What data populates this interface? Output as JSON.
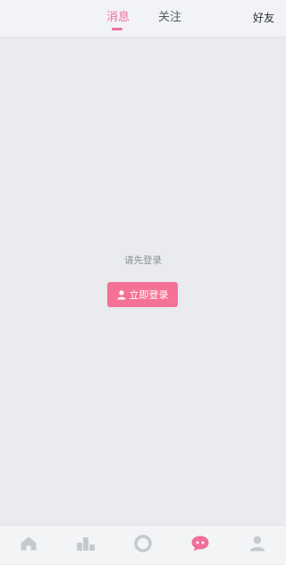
{
  "header": {
    "tabs": [
      {
        "label": "消息",
        "active": true
      },
      {
        "label": "关注",
        "active": false
      }
    ],
    "friends_label": "好友"
  },
  "empty_state": {
    "prompt": "请先登录",
    "login_button": "立即登录"
  },
  "bottom_nav": {
    "items": [
      {
        "icon": "home-icon",
        "active": false
      },
      {
        "icon": "ranking-icon",
        "active": false
      },
      {
        "icon": "circle-icon",
        "active": false
      },
      {
        "icon": "chat-bubble-icon",
        "active": true
      },
      {
        "icon": "user-icon",
        "active": false
      }
    ]
  },
  "colors": {
    "accent": "#f0709a",
    "button": "#f57195",
    "inactive_icon": "#c6c9cf",
    "background": "#e9ebee"
  }
}
